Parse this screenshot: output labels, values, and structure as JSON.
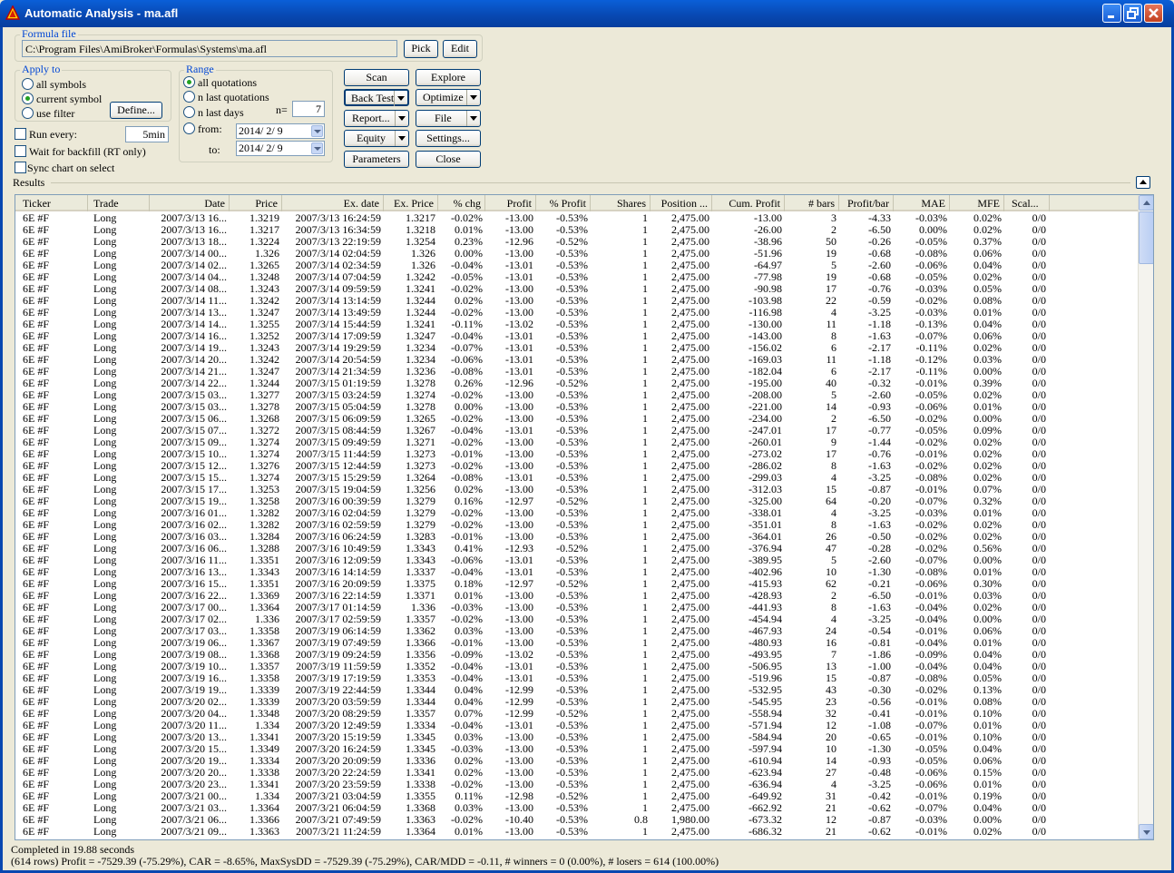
{
  "window": {
    "title": "Automatic Analysis - ma.afl"
  },
  "formula": {
    "group_label": "Formula file",
    "path": "C:\\Program Files\\AmiBroker\\Formulas\\Systems\\ma.afl",
    "pick_label": "Pick",
    "edit_label": "Edit"
  },
  "apply_to": {
    "group_label": "Apply to",
    "options": [
      "all symbols",
      "current symbol",
      "use filter"
    ],
    "selected": "current symbol",
    "define_label": "Define..."
  },
  "range": {
    "group_label": "Range",
    "options": [
      "all quotations",
      "n last quotations",
      "n last days",
      "from:"
    ],
    "selected": "all quotations",
    "n_label": "n=",
    "n_value": "7",
    "to_label": "to:",
    "from_date": "2014/ 2/ 9",
    "to_date": "2014/ 2/ 9"
  },
  "run_every": {
    "label": "Run every:",
    "value": "5min",
    "checked": false
  },
  "wait_backfill": {
    "label": "Wait for backfill (RT only)",
    "checked": false
  },
  "sync_chart": {
    "label": "Sync chart on select",
    "checked": false
  },
  "buttons": {
    "scan": "Scan",
    "explore": "Explore",
    "backtest": "Back Test",
    "optimize": "Optimize",
    "report": "Report...",
    "file": "File",
    "equity": "Equity",
    "settings": "Settings...",
    "parameters": "Parameters",
    "close": "Close"
  },
  "results_label": "Results",
  "columns": [
    "Ticker",
    "Trade",
    "Date",
    "Price",
    "Ex. date",
    "Ex. Price",
    "% chg",
    "Profit",
    "% Profit",
    "Shares",
    "Position ...",
    "Cum. Profit",
    "# bars",
    "Profit/bar",
    "MAE",
    "MFE",
    "Scal..."
  ],
  "rows": [
    [
      "6E #F",
      "Long",
      "2007/3/13 16...",
      "1.3219",
      "2007/3/13 16:24:59",
      "1.3217",
      "-0.02%",
      "-13.00",
      "-0.53%",
      "1",
      "2,475.00",
      "-13.00",
      "3",
      "-4.33",
      "-0.03%",
      "0.02%",
      "0/0"
    ],
    [
      "6E #F",
      "Long",
      "2007/3/13 16...",
      "1.3217",
      "2007/3/13 16:34:59",
      "1.3218",
      "0.01%",
      "-13.00",
      "-0.53%",
      "1",
      "2,475.00",
      "-26.00",
      "2",
      "-6.50",
      "0.00%",
      "0.02%",
      "0/0"
    ],
    [
      "6E #F",
      "Long",
      "2007/3/13 18...",
      "1.3224",
      "2007/3/13 22:19:59",
      "1.3254",
      "0.23%",
      "-12.96",
      "-0.52%",
      "1",
      "2,475.00",
      "-38.96",
      "50",
      "-0.26",
      "-0.05%",
      "0.37%",
      "0/0"
    ],
    [
      "6E #F",
      "Long",
      "2007/3/14 00...",
      "1.326",
      "2007/3/14 02:04:59",
      "1.326",
      "0.00%",
      "-13.00",
      "-0.53%",
      "1",
      "2,475.00",
      "-51.96",
      "19",
      "-0.68",
      "-0.08%",
      "0.06%",
      "0/0"
    ],
    [
      "6E #F",
      "Long",
      "2007/3/14 02...",
      "1.3265",
      "2007/3/14 02:34:59",
      "1.326",
      "-0.04%",
      "-13.01",
      "-0.53%",
      "1",
      "2,475.00",
      "-64.97",
      "5",
      "-2.60",
      "-0.06%",
      "0.04%",
      "0/0"
    ],
    [
      "6E #F",
      "Long",
      "2007/3/14 04...",
      "1.3248",
      "2007/3/14 07:04:59",
      "1.3242",
      "-0.05%",
      "-13.01",
      "-0.53%",
      "1",
      "2,475.00",
      "-77.98",
      "19",
      "-0.68",
      "-0.05%",
      "0.02%",
      "0/0"
    ],
    [
      "6E #F",
      "Long",
      "2007/3/14 08...",
      "1.3243",
      "2007/3/14 09:59:59",
      "1.3241",
      "-0.02%",
      "-13.00",
      "-0.53%",
      "1",
      "2,475.00",
      "-90.98",
      "17",
      "-0.76",
      "-0.03%",
      "0.05%",
      "0/0"
    ],
    [
      "6E #F",
      "Long",
      "2007/3/14 11...",
      "1.3242",
      "2007/3/14 13:14:59",
      "1.3244",
      "0.02%",
      "-13.00",
      "-0.53%",
      "1",
      "2,475.00",
      "-103.98",
      "22",
      "-0.59",
      "-0.02%",
      "0.08%",
      "0/0"
    ],
    [
      "6E #F",
      "Long",
      "2007/3/14 13...",
      "1.3247",
      "2007/3/14 13:49:59",
      "1.3244",
      "-0.02%",
      "-13.00",
      "-0.53%",
      "1",
      "2,475.00",
      "-116.98",
      "4",
      "-3.25",
      "-0.03%",
      "0.01%",
      "0/0"
    ],
    [
      "6E #F",
      "Long",
      "2007/3/14 14...",
      "1.3255",
      "2007/3/14 15:44:59",
      "1.3241",
      "-0.11%",
      "-13.02",
      "-0.53%",
      "1",
      "2,475.00",
      "-130.00",
      "11",
      "-1.18",
      "-0.13%",
      "0.04%",
      "0/0"
    ],
    [
      "6E #F",
      "Long",
      "2007/3/14 16...",
      "1.3252",
      "2007/3/14 17:09:59",
      "1.3247",
      "-0.04%",
      "-13.01",
      "-0.53%",
      "1",
      "2,475.00",
      "-143.00",
      "8",
      "-1.63",
      "-0.07%",
      "0.06%",
      "0/0"
    ],
    [
      "6E #F",
      "Long",
      "2007/3/14 19...",
      "1.3243",
      "2007/3/14 19:29:59",
      "1.3234",
      "-0.07%",
      "-13.01",
      "-0.53%",
      "1",
      "2,475.00",
      "-156.02",
      "6",
      "-2.17",
      "-0.11%",
      "0.02%",
      "0/0"
    ],
    [
      "6E #F",
      "Long",
      "2007/3/14 20...",
      "1.3242",
      "2007/3/14 20:54:59",
      "1.3234",
      "-0.06%",
      "-13.01",
      "-0.53%",
      "1",
      "2,475.00",
      "-169.03",
      "11",
      "-1.18",
      "-0.12%",
      "0.03%",
      "0/0"
    ],
    [
      "6E #F",
      "Long",
      "2007/3/14 21...",
      "1.3247",
      "2007/3/14 21:34:59",
      "1.3236",
      "-0.08%",
      "-13.01",
      "-0.53%",
      "1",
      "2,475.00",
      "-182.04",
      "6",
      "-2.17",
      "-0.11%",
      "0.00%",
      "0/0"
    ],
    [
      "6E #F",
      "Long",
      "2007/3/14 22...",
      "1.3244",
      "2007/3/15 01:19:59",
      "1.3278",
      "0.26%",
      "-12.96",
      "-0.52%",
      "1",
      "2,475.00",
      "-195.00",
      "40",
      "-0.32",
      "-0.01%",
      "0.39%",
      "0/0"
    ],
    [
      "6E #F",
      "Long",
      "2007/3/15 03...",
      "1.3277",
      "2007/3/15 03:24:59",
      "1.3274",
      "-0.02%",
      "-13.00",
      "-0.53%",
      "1",
      "2,475.00",
      "-208.00",
      "5",
      "-2.60",
      "-0.05%",
      "0.02%",
      "0/0"
    ],
    [
      "6E #F",
      "Long",
      "2007/3/15 03...",
      "1.3278",
      "2007/3/15 05:04:59",
      "1.3278",
      "0.00%",
      "-13.00",
      "-0.53%",
      "1",
      "2,475.00",
      "-221.00",
      "14",
      "-0.93",
      "-0.06%",
      "0.01%",
      "0/0"
    ],
    [
      "6E #F",
      "Long",
      "2007/3/15 06...",
      "1.3268",
      "2007/3/15 06:09:59",
      "1.3265",
      "-0.02%",
      "-13.00",
      "-0.53%",
      "1",
      "2,475.00",
      "-234.00",
      "2",
      "-6.50",
      "-0.02%",
      "0.00%",
      "0/0"
    ],
    [
      "6E #F",
      "Long",
      "2007/3/15 07...",
      "1.3272",
      "2007/3/15 08:44:59",
      "1.3267",
      "-0.04%",
      "-13.01",
      "-0.53%",
      "1",
      "2,475.00",
      "-247.01",
      "17",
      "-0.77",
      "-0.05%",
      "0.09%",
      "0/0"
    ],
    [
      "6E #F",
      "Long",
      "2007/3/15 09...",
      "1.3274",
      "2007/3/15 09:49:59",
      "1.3271",
      "-0.02%",
      "-13.00",
      "-0.53%",
      "1",
      "2,475.00",
      "-260.01",
      "9",
      "-1.44",
      "-0.02%",
      "0.02%",
      "0/0"
    ],
    [
      "6E #F",
      "Long",
      "2007/3/15 10...",
      "1.3274",
      "2007/3/15 11:44:59",
      "1.3273",
      "-0.01%",
      "-13.00",
      "-0.53%",
      "1",
      "2,475.00",
      "-273.02",
      "17",
      "-0.76",
      "-0.01%",
      "0.02%",
      "0/0"
    ],
    [
      "6E #F",
      "Long",
      "2007/3/15 12...",
      "1.3276",
      "2007/3/15 12:44:59",
      "1.3273",
      "-0.02%",
      "-13.00",
      "-0.53%",
      "1",
      "2,475.00",
      "-286.02",
      "8",
      "-1.63",
      "-0.02%",
      "0.02%",
      "0/0"
    ],
    [
      "6E #F",
      "Long",
      "2007/3/15 15...",
      "1.3274",
      "2007/3/15 15:29:59",
      "1.3264",
      "-0.08%",
      "-13.01",
      "-0.53%",
      "1",
      "2,475.00",
      "-299.03",
      "4",
      "-3.25",
      "-0.08%",
      "0.02%",
      "0/0"
    ],
    [
      "6E #F",
      "Long",
      "2007/3/15 17...",
      "1.3253",
      "2007/3/15 19:04:59",
      "1.3256",
      "0.02%",
      "-13.00",
      "-0.53%",
      "1",
      "2,475.00",
      "-312.03",
      "15",
      "-0.87",
      "-0.01%",
      "0.07%",
      "0/0"
    ],
    [
      "6E #F",
      "Long",
      "2007/3/15 19...",
      "1.3258",
      "2007/3/16 00:39:59",
      "1.3279",
      "0.16%",
      "-12.97",
      "-0.52%",
      "1",
      "2,475.00",
      "-325.00",
      "64",
      "-0.20",
      "-0.07%",
      "0.32%",
      "0/0"
    ],
    [
      "6E #F",
      "Long",
      "2007/3/16 01...",
      "1.3282",
      "2007/3/16 02:04:59",
      "1.3279",
      "-0.02%",
      "-13.00",
      "-0.53%",
      "1",
      "2,475.00",
      "-338.01",
      "4",
      "-3.25",
      "-0.03%",
      "0.01%",
      "0/0"
    ],
    [
      "6E #F",
      "Long",
      "2007/3/16 02...",
      "1.3282",
      "2007/3/16 02:59:59",
      "1.3279",
      "-0.02%",
      "-13.00",
      "-0.53%",
      "1",
      "2,475.00",
      "-351.01",
      "8",
      "-1.63",
      "-0.02%",
      "0.02%",
      "0/0"
    ],
    [
      "6E #F",
      "Long",
      "2007/3/16 03...",
      "1.3284",
      "2007/3/16 06:24:59",
      "1.3283",
      "-0.01%",
      "-13.00",
      "-0.53%",
      "1",
      "2,475.00",
      "-364.01",
      "26",
      "-0.50",
      "-0.02%",
      "0.02%",
      "0/0"
    ],
    [
      "6E #F",
      "Long",
      "2007/3/16 06...",
      "1.3288",
      "2007/3/16 10:49:59",
      "1.3343",
      "0.41%",
      "-12.93",
      "-0.52%",
      "1",
      "2,475.00",
      "-376.94",
      "47",
      "-0.28",
      "-0.02%",
      "0.56%",
      "0/0"
    ],
    [
      "6E #F",
      "Long",
      "2007/3/16 11...",
      "1.3351",
      "2007/3/16 12:09:59",
      "1.3343",
      "-0.06%",
      "-13.01",
      "-0.53%",
      "1",
      "2,475.00",
      "-389.95",
      "5",
      "-2.60",
      "-0.07%",
      "0.00%",
      "0/0"
    ],
    [
      "6E #F",
      "Long",
      "2007/3/16 13...",
      "1.3343",
      "2007/3/16 14:14:59",
      "1.3337",
      "-0.04%",
      "-13.01",
      "-0.53%",
      "1",
      "2,475.00",
      "-402.96",
      "10",
      "-1.30",
      "-0.08%",
      "0.01%",
      "0/0"
    ],
    [
      "6E #F",
      "Long",
      "2007/3/16 15...",
      "1.3351",
      "2007/3/16 20:09:59",
      "1.3375",
      "0.18%",
      "-12.97",
      "-0.52%",
      "1",
      "2,475.00",
      "-415.93",
      "62",
      "-0.21",
      "-0.06%",
      "0.30%",
      "0/0"
    ],
    [
      "6E #F",
      "Long",
      "2007/3/16 22...",
      "1.3369",
      "2007/3/16 22:14:59",
      "1.3371",
      "0.01%",
      "-13.00",
      "-0.53%",
      "1",
      "2,475.00",
      "-428.93",
      "2",
      "-6.50",
      "-0.01%",
      "0.03%",
      "0/0"
    ],
    [
      "6E #F",
      "Long",
      "2007/3/17 00...",
      "1.3364",
      "2007/3/17 01:14:59",
      "1.336",
      "-0.03%",
      "-13.00",
      "-0.53%",
      "1",
      "2,475.00",
      "-441.93",
      "8",
      "-1.63",
      "-0.04%",
      "0.02%",
      "0/0"
    ],
    [
      "6E #F",
      "Long",
      "2007/3/17 02...",
      "1.336",
      "2007/3/17 02:59:59",
      "1.3357",
      "-0.02%",
      "-13.00",
      "-0.53%",
      "1",
      "2,475.00",
      "-454.94",
      "4",
      "-3.25",
      "-0.04%",
      "0.00%",
      "0/0"
    ],
    [
      "6E #F",
      "Long",
      "2007/3/17 03...",
      "1.3358",
      "2007/3/19 06:14:59",
      "1.3362",
      "0.03%",
      "-13.00",
      "-0.53%",
      "1",
      "2,475.00",
      "-467.93",
      "24",
      "-0.54",
      "-0.01%",
      "0.06%",
      "0/0"
    ],
    [
      "6E #F",
      "Long",
      "2007/3/19 06...",
      "1.3367",
      "2007/3/19 07:49:59",
      "1.3366",
      "-0.01%",
      "-13.00",
      "-0.53%",
      "1",
      "2,475.00",
      "-480.93",
      "16",
      "-0.81",
      "-0.04%",
      "0.01%",
      "0/0"
    ],
    [
      "6E #F",
      "Long",
      "2007/3/19 08...",
      "1.3368",
      "2007/3/19 09:24:59",
      "1.3356",
      "-0.09%",
      "-13.02",
      "-0.53%",
      "1",
      "2,475.00",
      "-493.95",
      "7",
      "-1.86",
      "-0.09%",
      "0.04%",
      "0/0"
    ],
    [
      "6E #F",
      "Long",
      "2007/3/19 10...",
      "1.3357",
      "2007/3/19 11:59:59",
      "1.3352",
      "-0.04%",
      "-13.01",
      "-0.53%",
      "1",
      "2,475.00",
      "-506.95",
      "13",
      "-1.00",
      "-0.04%",
      "0.04%",
      "0/0"
    ],
    [
      "6E #F",
      "Long",
      "2007/3/19 16...",
      "1.3358",
      "2007/3/19 17:19:59",
      "1.3353",
      "-0.04%",
      "-13.01",
      "-0.53%",
      "1",
      "2,475.00",
      "-519.96",
      "15",
      "-0.87",
      "-0.08%",
      "0.05%",
      "0/0"
    ],
    [
      "6E #F",
      "Long",
      "2007/3/19 19...",
      "1.3339",
      "2007/3/19 22:44:59",
      "1.3344",
      "0.04%",
      "-12.99",
      "-0.53%",
      "1",
      "2,475.00",
      "-532.95",
      "43",
      "-0.30",
      "-0.02%",
      "0.13%",
      "0/0"
    ],
    [
      "6E #F",
      "Long",
      "2007/3/20 02...",
      "1.3339",
      "2007/3/20 03:59:59",
      "1.3344",
      "0.04%",
      "-12.99",
      "-0.53%",
      "1",
      "2,475.00",
      "-545.95",
      "23",
      "-0.56",
      "-0.01%",
      "0.08%",
      "0/0"
    ],
    [
      "6E #F",
      "Long",
      "2007/3/20 04...",
      "1.3348",
      "2007/3/20 08:29:59",
      "1.3357",
      "0.07%",
      "-12.99",
      "-0.52%",
      "1",
      "2,475.00",
      "-558.94",
      "32",
      "-0.41",
      "-0.01%",
      "0.10%",
      "0/0"
    ],
    [
      "6E #F",
      "Long",
      "2007/3/20 11...",
      "1.334",
      "2007/3/20 12:49:59",
      "1.3334",
      "-0.04%",
      "-13.01",
      "-0.53%",
      "1",
      "2,475.00",
      "-571.94",
      "12",
      "-1.08",
      "-0.07%",
      "0.01%",
      "0/0"
    ],
    [
      "6E #F",
      "Long",
      "2007/3/20 13...",
      "1.3341",
      "2007/3/20 15:19:59",
      "1.3345",
      "0.03%",
      "-13.00",
      "-0.53%",
      "1",
      "2,475.00",
      "-584.94",
      "20",
      "-0.65",
      "-0.01%",
      "0.10%",
      "0/0"
    ],
    [
      "6E #F",
      "Long",
      "2007/3/20 15...",
      "1.3349",
      "2007/3/20 16:24:59",
      "1.3345",
      "-0.03%",
      "-13.00",
      "-0.53%",
      "1",
      "2,475.00",
      "-597.94",
      "10",
      "-1.30",
      "-0.05%",
      "0.04%",
      "0/0"
    ],
    [
      "6E #F",
      "Long",
      "2007/3/20 19...",
      "1.3334",
      "2007/3/20 20:09:59",
      "1.3336",
      "0.02%",
      "-13.00",
      "-0.53%",
      "1",
      "2,475.00",
      "-610.94",
      "14",
      "-0.93",
      "-0.05%",
      "0.06%",
      "0/0"
    ],
    [
      "6E #F",
      "Long",
      "2007/3/20 20...",
      "1.3338",
      "2007/3/20 22:24:59",
      "1.3341",
      "0.02%",
      "-13.00",
      "-0.53%",
      "1",
      "2,475.00",
      "-623.94",
      "27",
      "-0.48",
      "-0.06%",
      "0.15%",
      "0/0"
    ],
    [
      "6E #F",
      "Long",
      "2007/3/20 23...",
      "1.3341",
      "2007/3/20 23:59:59",
      "1.3338",
      "-0.02%",
      "-13.00",
      "-0.53%",
      "1",
      "2,475.00",
      "-636.94",
      "4",
      "-3.25",
      "-0.06%",
      "0.01%",
      "0/0"
    ],
    [
      "6E #F",
      "Long",
      "2007/3/21 00...",
      "1.334",
      "2007/3/21 03:04:59",
      "1.3355",
      "0.11%",
      "-12.98",
      "-0.52%",
      "1",
      "2,475.00",
      "-649.92",
      "31",
      "-0.42",
      "-0.01%",
      "0.19%",
      "0/0"
    ],
    [
      "6E #F",
      "Long",
      "2007/3/21 03...",
      "1.3364",
      "2007/3/21 06:04:59",
      "1.3368",
      "0.03%",
      "-13.00",
      "-0.53%",
      "1",
      "2,475.00",
      "-662.92",
      "21",
      "-0.62",
      "-0.07%",
      "0.04%",
      "0/0"
    ],
    [
      "6E #F",
      "Long",
      "2007/3/21 06...",
      "1.3366",
      "2007/3/21 07:49:59",
      "1.3363",
      "-0.02%",
      "-10.40",
      "-0.53%",
      "0.8",
      "1,980.00",
      "-673.32",
      "12",
      "-0.87",
      "-0.03%",
      "0.00%",
      "0/0"
    ],
    [
      "6E #F",
      "Long",
      "2007/3/21 09...",
      "1.3363",
      "2007/3/21 11:24:59",
      "1.3364",
      "0.01%",
      "-13.00",
      "-0.53%",
      "1",
      "2,475.00",
      "-686.32",
      "21",
      "-0.62",
      "-0.01%",
      "0.02%",
      "0/0"
    ]
  ],
  "status": {
    "line1": "Completed in 19.88 seconds",
    "line2": "(614 rows) Profit = -7529.39 (-75.29%), CAR = -8.65%, MaxSysDD = -7529.39 (-75.29%), CAR/MDD = -0.11, # winners = 0 (0.00%), # losers = 614 (100.00%)"
  },
  "colors": {
    "title_bar": "#0847b0",
    "dialog_bg": "#ece9d8",
    "group_label": "#0046d5"
  }
}
